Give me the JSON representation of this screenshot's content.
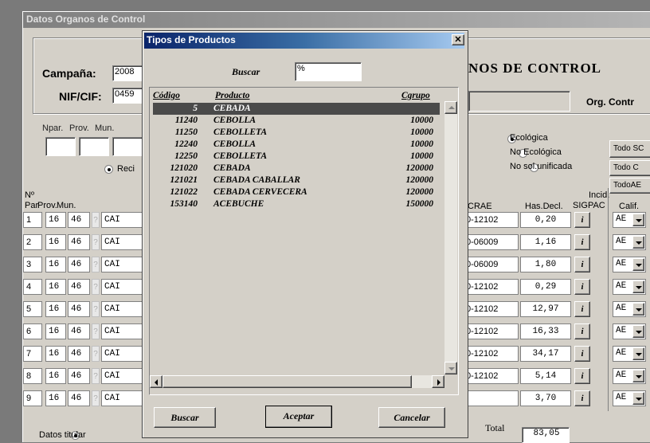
{
  "main": {
    "title": "Datos Organos de Control",
    "campana_label": "Campaña:",
    "campana_value": "2008",
    "nif_label": "NIF/CIF:",
    "nif_value": "0459",
    "header_title": "NOS DE CONTROL",
    "org_label": "Org. Contr",
    "npar_label": "Npar.",
    "prov_label": "Prov.",
    "mun_label": "Mun.",
    "reci_label": "Reci",
    "radios": [
      "Ecológica",
      "No Ecológica",
      "No sol.unificada"
    ],
    "side_buttons": [
      "Todo SC",
      "Todo C",
      "TodoAE"
    ],
    "n_label": "Nº",
    "col_par": "Par",
    "col_prov": "Prov.",
    "col_mun": "Mun.",
    "col_crae": "CRAE",
    "col_has": "Has.Decl.",
    "col_incid": "Incid.",
    "col_sigpac": "SIGPAC",
    "col_calif": "Calif.",
    "info_btn": "i",
    "total_label": "Total",
    "total_value": "83,05",
    "bottom_radio": "Datos titular",
    "rows": [
      {
        "n": "1",
        "prov": "16",
        "mun": "46",
        "q": "?",
        "txt": "CAI",
        "crae": "0-12102",
        "has": "0,20",
        "calif": "AE"
      },
      {
        "n": "2",
        "prov": "16",
        "mun": "46",
        "q": "?",
        "txt": "CAI",
        "crae": "0-06009",
        "has": "1,16",
        "calif": "AE"
      },
      {
        "n": "3",
        "prov": "16",
        "mun": "46",
        "q": "?",
        "txt": "CAI",
        "crae": "0-06009",
        "has": "1,80",
        "calif": "AE"
      },
      {
        "n": "4",
        "prov": "16",
        "mun": "46",
        "q": "?",
        "txt": "CAI",
        "crae": "0-12102",
        "has": "0,29",
        "calif": "AE"
      },
      {
        "n": "5",
        "prov": "16",
        "mun": "46",
        "q": "?",
        "txt": "CAI",
        "crae": "0-12102",
        "has": "12,97",
        "calif": "AE"
      },
      {
        "n": "6",
        "prov": "16",
        "mun": "46",
        "q": "?",
        "txt": "CAI",
        "crae": "0-12102",
        "has": "16,33",
        "calif": "AE"
      },
      {
        "n": "7",
        "prov": "16",
        "mun": "46",
        "q": "?",
        "txt": "CAI",
        "crae": "0-12102",
        "has": "34,17",
        "calif": "AE"
      },
      {
        "n": "8",
        "prov": "16",
        "mun": "46",
        "q": "?",
        "txt": "CAI",
        "crae": "0-12102",
        "has": "5,14",
        "calif": "AE"
      },
      {
        "n": "9",
        "prov": "16",
        "mun": "46",
        "q": "?",
        "txt": "CAI",
        "crae": "",
        "has": "3,70",
        "calif": "AE"
      }
    ]
  },
  "dialog": {
    "title": "Tipos de Productos",
    "close": "✕",
    "buscar_label": "Buscar",
    "buscar_value": "%",
    "col_codigo": "Código",
    "col_producto": "Producto",
    "col_cgrupo": "Cgrupo",
    "items": [
      {
        "codigo": "5",
        "producto": "CEBADA",
        "cgrupo": ""
      },
      {
        "codigo": "11240",
        "producto": "CEBOLLA",
        "cgrupo": "10000"
      },
      {
        "codigo": "11250",
        "producto": "CEBOLLETA",
        "cgrupo": "10000"
      },
      {
        "codigo": "12240",
        "producto": "CEBOLLA",
        "cgrupo": "10000"
      },
      {
        "codigo": "12250",
        "producto": "CEBOLLETA",
        "cgrupo": "10000"
      },
      {
        "codigo": "121020",
        "producto": "CEBADA",
        "cgrupo": "120000"
      },
      {
        "codigo": "121021",
        "producto": "CEBADA CABALLAR",
        "cgrupo": "120000"
      },
      {
        "codigo": "121022",
        "producto": "CEBADA CERVECERA",
        "cgrupo": "120000"
      },
      {
        "codigo": "153140",
        "producto": "ACEBUCHE",
        "cgrupo": "150000"
      }
    ],
    "btn_buscar": "Buscar",
    "btn_aceptar": "Aceptar",
    "btn_cancelar": "Cancelar"
  }
}
